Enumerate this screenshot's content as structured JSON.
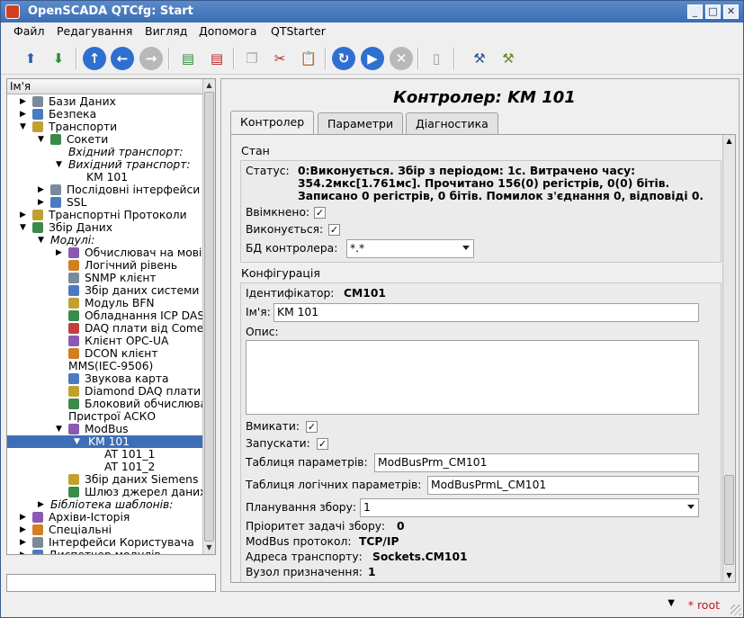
{
  "window": {
    "title": "OpenSCADA QTCfg: Start"
  },
  "menu": [
    "Файл",
    "Редагування",
    "Вигляд",
    "Допомога",
    "QTStarter"
  ],
  "tree": {
    "header": "Ім'я",
    "rows": [
      {
        "label": "Бази Даних",
        "indent": 0,
        "arrow": "right",
        "italic": false
      },
      {
        "label": "Безпека",
        "indent": 0,
        "arrow": "right",
        "italic": false
      },
      {
        "label": "Транспорти",
        "indent": 0,
        "arrow": "down",
        "italic": false
      },
      {
        "label": "Сокети",
        "indent": 1,
        "arrow": "down",
        "italic": false
      },
      {
        "label": "Вхідний транспорт:",
        "indent": 2,
        "arrow": "",
        "italic": true
      },
      {
        "label": "Вихідний транспорт:",
        "indent": 2,
        "arrow": "down",
        "italic": true
      },
      {
        "label": "KM 101",
        "indent": 3,
        "arrow": "",
        "italic": false
      },
      {
        "label": "Послідовні інтерфейси",
        "indent": 1,
        "arrow": "right",
        "italic": false
      },
      {
        "label": "SSL",
        "indent": 1,
        "arrow": "right",
        "italic": false
      },
      {
        "label": "Транспортні Протоколи",
        "indent": 0,
        "arrow": "right",
        "italic": false
      },
      {
        "label": "Збір Даних",
        "indent": 0,
        "arrow": "down",
        "italic": false
      },
      {
        "label": "Модулі:",
        "indent": 1,
        "arrow": "down",
        "italic": true
      },
      {
        "label": "Обчислювач на мові",
        "indent": 2,
        "arrow": "right",
        "italic": false
      },
      {
        "label": "Логічний рівень",
        "indent": 2,
        "arrow": "",
        "italic": false
      },
      {
        "label": "SNMP клієнт",
        "indent": 2,
        "arrow": "",
        "italic": false
      },
      {
        "label": "Збір даних системи",
        "indent": 2,
        "arrow": "",
        "italic": false
      },
      {
        "label": "Модуль BFN",
        "indent": 2,
        "arrow": "",
        "italic": false
      },
      {
        "label": "Обладнання ICP DAS",
        "indent": 2,
        "arrow": "",
        "italic": false
      },
      {
        "label": "DAQ плати від Comedi",
        "indent": 2,
        "arrow": "",
        "italic": false
      },
      {
        "label": "Клієнт OPC-UA",
        "indent": 2,
        "arrow": "",
        "italic": false
      },
      {
        "label": "DCON клієнт",
        "indent": 2,
        "arrow": "",
        "italic": false
      },
      {
        "label": "MMS(IEC-9506)",
        "indent": 2,
        "arrow": "",
        "italic": false,
        "noicon": true
      },
      {
        "label": "Звукова карта",
        "indent": 2,
        "arrow": "",
        "italic": false
      },
      {
        "label": "Diamond DAQ плати",
        "indent": 2,
        "arrow": "",
        "italic": false
      },
      {
        "label": "Блоковий обчислювач",
        "indent": 2,
        "arrow": "",
        "italic": false
      },
      {
        "label": "Пристрої АСКО",
        "indent": 2,
        "arrow": "",
        "italic": false,
        "noicon": true
      },
      {
        "label": "ModBus",
        "indent": 2,
        "arrow": "down",
        "italic": false
      },
      {
        "label": "KM 101",
        "indent": 3,
        "arrow": "down",
        "italic": false,
        "selected": true
      },
      {
        "label": "AT 101_1",
        "indent": 4,
        "arrow": "",
        "italic": false
      },
      {
        "label": "AT 101_2",
        "indent": 4,
        "arrow": "",
        "italic": false
      },
      {
        "label": "Збір даних Siemens",
        "indent": 2,
        "arrow": "",
        "italic": false
      },
      {
        "label": "Шлюз джерел даних",
        "indent": 2,
        "arrow": "",
        "italic": false
      },
      {
        "label": "Бібліотека шаблонів:",
        "indent": 1,
        "arrow": "right",
        "italic": true
      },
      {
        "label": "Архіви-Історія",
        "indent": 0,
        "arrow": "right",
        "italic": false
      },
      {
        "label": "Спеціальні",
        "indent": 0,
        "arrow": "right",
        "italic": false
      },
      {
        "label": "Інтерфейси Користувача",
        "indent": 0,
        "arrow": "right",
        "italic": false
      },
      {
        "label": "Диспетчер модулів",
        "indent": 0,
        "arrow": "right",
        "italic": false
      }
    ]
  },
  "page": {
    "title": "Контролер: KM 101",
    "tabs": [
      "Контролер",
      "Параметри",
      "Діагностика"
    ],
    "state_group": "Стан",
    "status_label": "Статус:",
    "status_lines": [
      "0:Виконується. Збір з періодом: 1с. Витрачено часу:",
      "354.2мкс[1.761мс]. Прочитано 156(0) регістрів, 0(0) бітів.",
      "Записано 0 регістрів, 0 бітів. Помилок з'єднання 0, відповіді 0."
    ],
    "enabled_label": "Ввімкнено:",
    "running_label": "Виконується:",
    "db_label": "БД контролера:",
    "db_value": "*.*",
    "config_group": "Конфігурація",
    "id_label": "Ідентифікатор:",
    "id_value": "CM101",
    "name_label": "Ім'я:",
    "name_value": "KM 101",
    "descr_label": "Опис:",
    "to_enable_label": "Вмикати:",
    "to_start_label": "Запускати:",
    "prm_table_label": "Таблиця параметрів:",
    "prm_table_value": "ModBusPrm_CM101",
    "prml_table_label": "Таблиця логічних параметрів:",
    "prml_table_value": "ModBusPrmL_CM101",
    "schedule_label": "Планування збору:",
    "schedule_value": "1",
    "priority_label": "Пріоритет задачі збору:",
    "priority_value": "0",
    "protocol_label": "ModBus протокол:",
    "protocol_value": "TCP/IP",
    "transport_label": "Адреса транспорту:",
    "transport_value": "Sockets.CM101",
    "node_label": "Вузол призначення:",
    "node_value": "1"
  },
  "status": {
    "user": "root",
    "marker": "*"
  }
}
